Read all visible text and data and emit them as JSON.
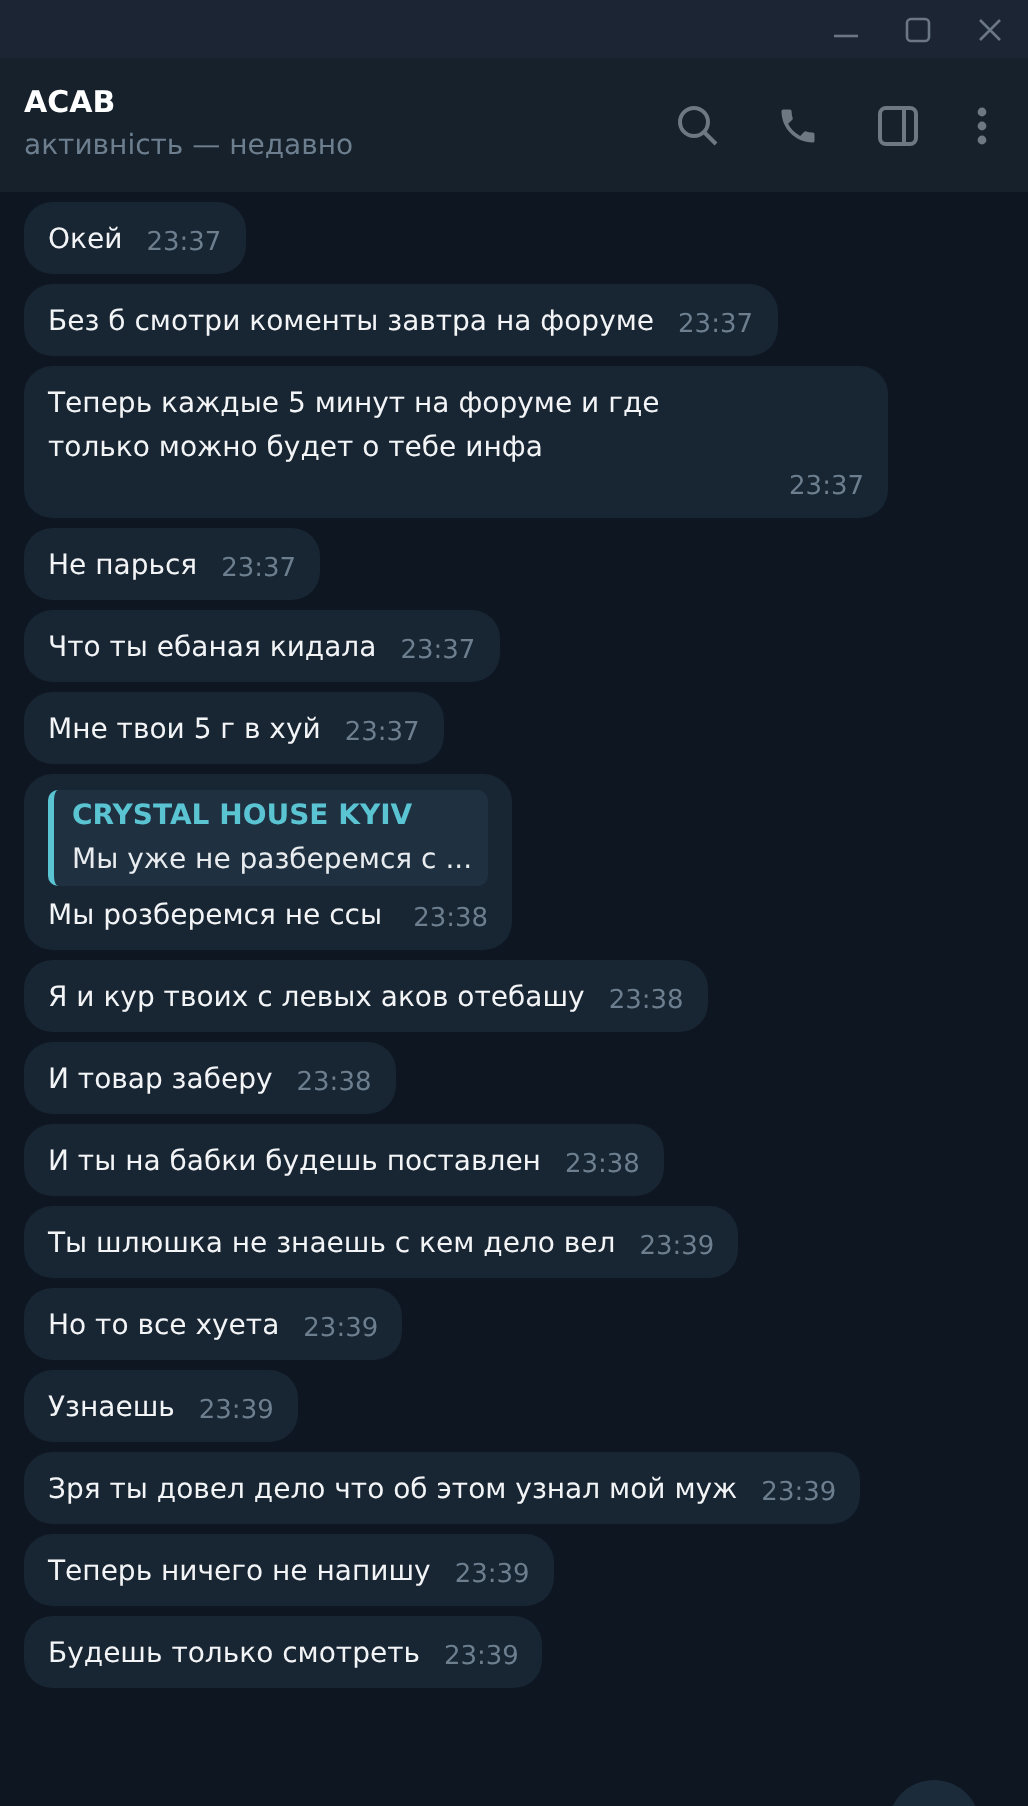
{
  "chat": {
    "title": "ACAB",
    "status": "активність — недавно"
  },
  "messages": [
    {
      "text": "Окей",
      "time": "23:37"
    },
    {
      "text": "Без б смотри коменты завтра на форуме",
      "time": "23:37"
    },
    {
      "text": "Теперь каждые 5 минут на форуме и где только можно будет о тебе инфа",
      "time": "23:37"
    },
    {
      "text": "Не парься",
      "time": "23:37"
    },
    {
      "text": "Что ты ебаная кидала",
      "time": "23:37"
    },
    {
      "text": "Мне твои 5 г в хуй",
      "time": "23:37"
    },
    {
      "text": "Мы розберемся не ссы",
      "time": "23:38",
      "reply": {
        "author": "CRYSTAL HOUSE KYIV",
        "text": "Мы уже не разберемся с ..."
      }
    },
    {
      "text": "Я и кур твоих с левых аков отебашу",
      "time": "23:38"
    },
    {
      "text": "И товар заберу",
      "time": "23:38"
    },
    {
      "text": "И ты на бабки будешь поставлен",
      "time": "23:38"
    },
    {
      "text": "Ты шлюшка не знаешь с кем дело вел",
      "time": "23:39"
    },
    {
      "text": "Но то все хуета",
      "time": "23:39"
    },
    {
      "text": "Узнаешь",
      "time": "23:39"
    },
    {
      "text": "Зря ты довел дело что об этом узнал мой муж",
      "time": "23:39"
    },
    {
      "text": "Теперь ничего не напишу",
      "time": "23:39"
    },
    {
      "text": "Будешь только смотреть",
      "time": "23:39"
    }
  ]
}
